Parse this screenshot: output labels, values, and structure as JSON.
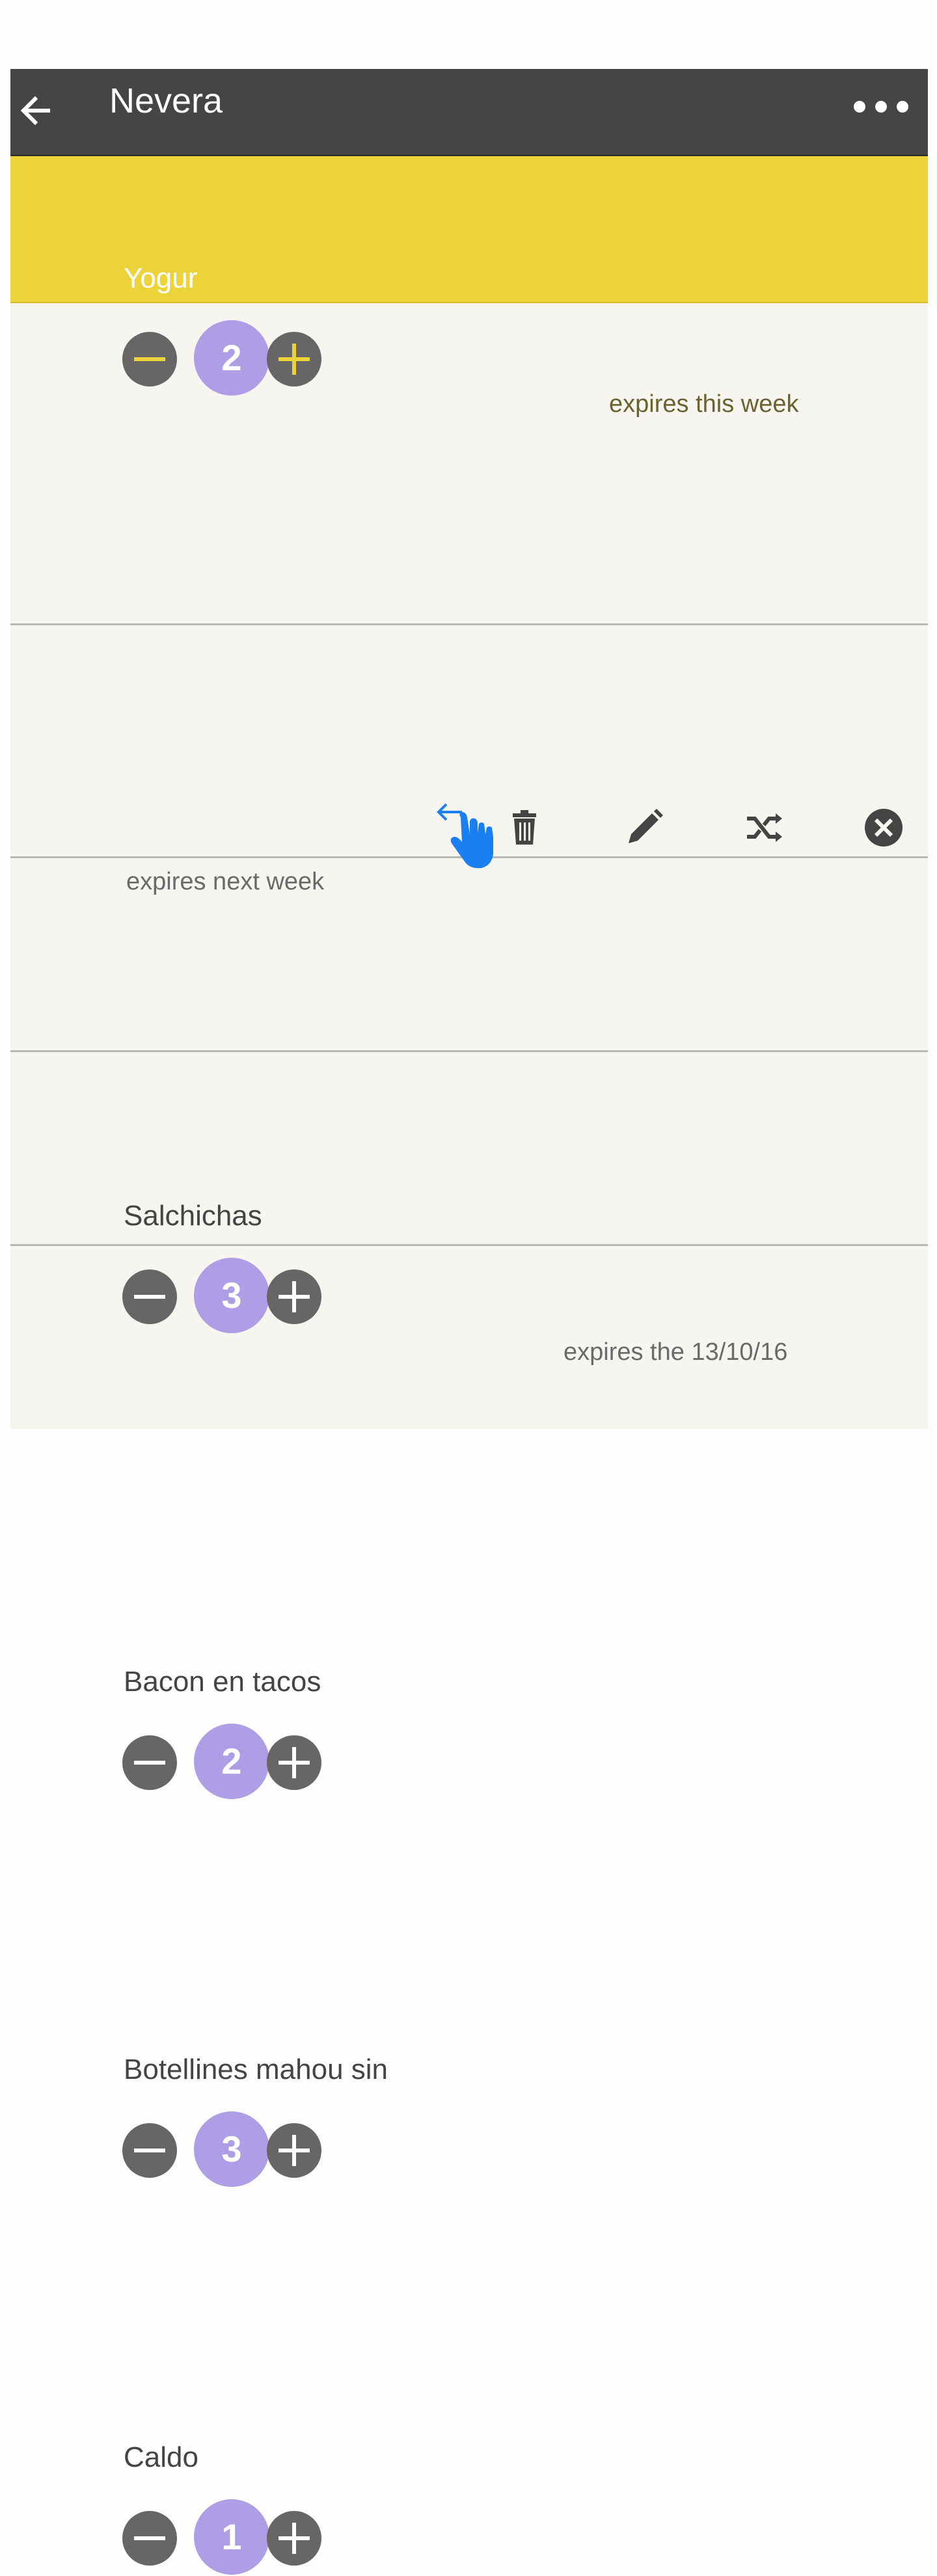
{
  "header": {
    "back_icon": "arrow-left-icon",
    "title": "Nevera",
    "menu_icon": "more-horizontal-icon"
  },
  "items": [
    {
      "name": "Yogur",
      "quantity": "2",
      "expiry": "expires this week",
      "highlighted": true
    },
    {
      "name": "",
      "quantity": "",
      "expiry": "expires next week",
      "actions": [
        "trash-icon",
        "pencil-icon",
        "shuffle-icon",
        "close-circle-icon"
      ]
    },
    {
      "name": "Salchichas",
      "quantity": "3",
      "expiry": "expires the 13/10/16"
    },
    {
      "name": "Bacon en tacos",
      "quantity": "2",
      "expiry": ""
    },
    {
      "name": "Botellines mahou sin",
      "quantity": "3",
      "expiry": ""
    },
    {
      "name": "Caldo",
      "quantity": "1",
      "expiry": ""
    }
  ],
  "overlay": {
    "gesture_icon": "swipe-left-hand-icon",
    "color": "#1a7ff0"
  },
  "colors": {
    "toolbar": "#454545",
    "highlight": "#ecd33a",
    "quantity_bubble": "#ad9ee6",
    "stepper_button": "#666666",
    "list_background": "#f6f5f0"
  }
}
